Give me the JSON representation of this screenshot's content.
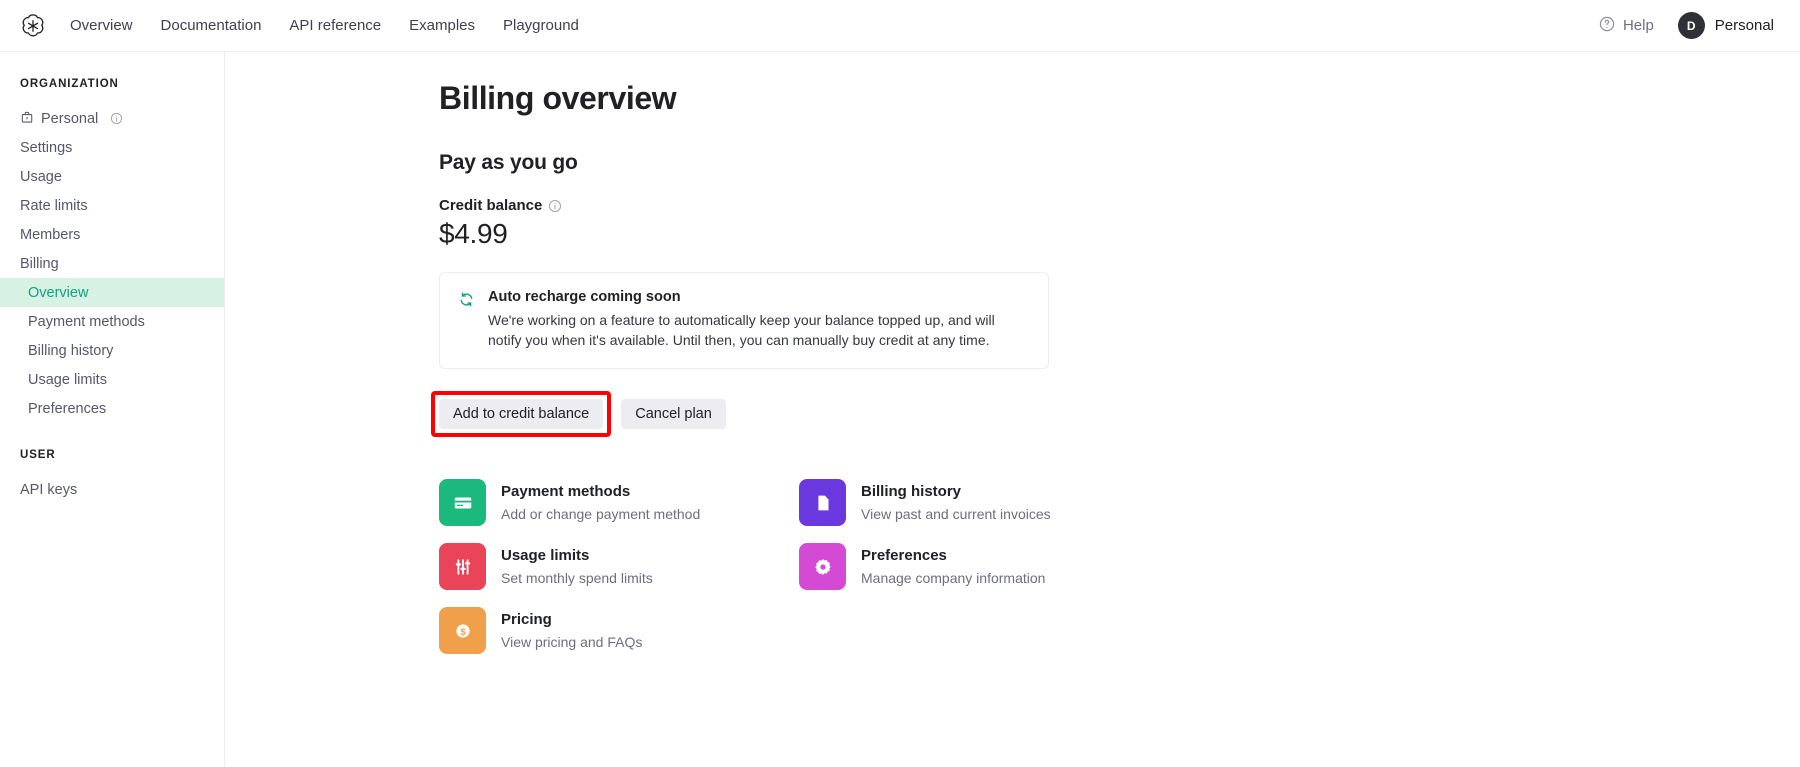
{
  "topnav": {
    "logo_icon": "openai-logo-icon",
    "links": [
      {
        "label": "Overview"
      },
      {
        "label": "Documentation"
      },
      {
        "label": "API reference"
      },
      {
        "label": "Examples"
      },
      {
        "label": "Playground"
      }
    ],
    "help": {
      "label": "Help",
      "icon": "question-circle-icon"
    },
    "account": {
      "avatar_initial": "D",
      "label": "Personal"
    }
  },
  "sidebar": {
    "organization_heading": "ORGANIZATION",
    "org_items": [
      {
        "label": "Personal",
        "icon": "organization-icon",
        "info_icon": "info-icon"
      },
      {
        "label": "Settings"
      },
      {
        "label": "Usage"
      },
      {
        "label": "Rate limits"
      },
      {
        "label": "Members"
      },
      {
        "label": "Billing"
      }
    ],
    "billing_subitems": [
      {
        "label": "Overview",
        "active": true
      },
      {
        "label": "Payment methods",
        "active": false
      },
      {
        "label": "Billing history",
        "active": false
      },
      {
        "label": "Usage limits",
        "active": false
      },
      {
        "label": "Preferences",
        "active": false
      }
    ],
    "user_heading": "USER",
    "user_items": [
      {
        "label": "API keys"
      }
    ],
    "active_color": "#10a37f",
    "active_bg": "#d7f1e4"
  },
  "main": {
    "page_title": "Billing overview",
    "section_title": "Pay as you go",
    "credit_balance_label": "Credit balance",
    "credit_balance_info_icon": "info-icon",
    "credit_balance_value": "$4.99",
    "notice": {
      "icon": "refresh-cycle-icon",
      "icon_color": "#10a37f",
      "title": "Auto recharge coming soon",
      "body": "We're working on a feature to automatically keep your balance topped up, and will notify you when it's available. Until then, you can manually buy credit at any time."
    },
    "buttons": {
      "primary_label": "Add to credit balance",
      "secondary_label": "Cancel plan",
      "highlight_color": "#ff0000"
    },
    "cards": [
      {
        "title": "Payment methods",
        "subtitle": "Add or change payment method",
        "icon": "credit-card-icon",
        "color": "#1cb97f"
      },
      {
        "title": "Billing history",
        "subtitle": "View past and current invoices",
        "icon": "document-icon",
        "color": "#6b38e0"
      },
      {
        "title": "Usage limits",
        "subtitle": "Set monthly spend limits",
        "icon": "sliders-icon",
        "color": "#ea4458"
      },
      {
        "title": "Preferences",
        "subtitle": "Manage company information",
        "icon": "gear-icon",
        "color": "#d44ad4"
      },
      {
        "title": "Pricing",
        "subtitle": "View pricing and FAQs",
        "icon": "dollar-coin-icon",
        "color": "#f0a04b"
      }
    ]
  }
}
